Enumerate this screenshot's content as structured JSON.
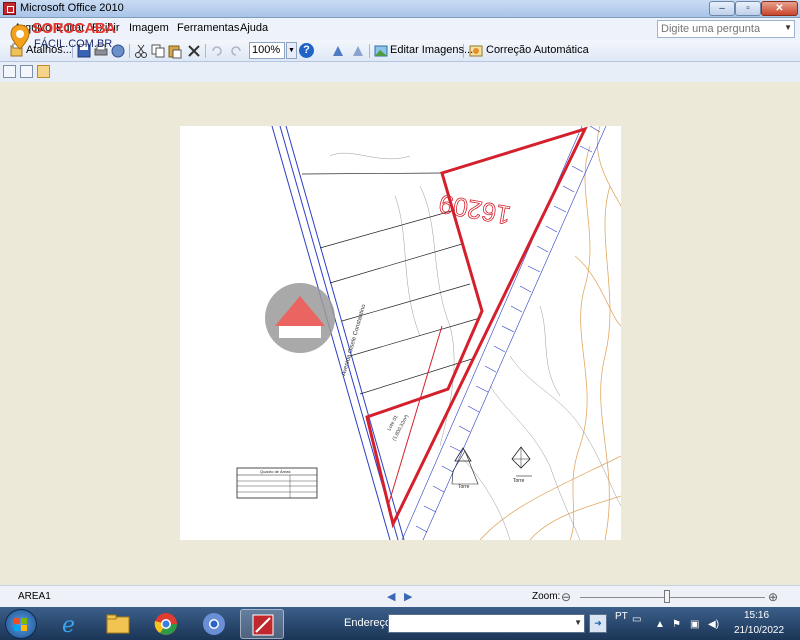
{
  "window": {
    "title": "Microsoft Office 2010"
  },
  "menu": [
    "Arquivo",
    "Editar",
    "Exibir",
    "Imagem",
    "Ferramentas",
    "Ajuda"
  ],
  "help_box": {
    "placeholder": "Digite uma pergunta"
  },
  "toolbar": {
    "atalhos_label": "Atalhos...",
    "zoom_value": "100%",
    "edit_images_label": "Editar Imagens...",
    "auto_correct_label": "Correção Automática"
  },
  "watermark": {
    "line1": "SOROCABA",
    "line2": "FÁCIL.COM.BR"
  },
  "document": {
    "stamp_number": "16209",
    "road_label": "Avenida Gisele Constantino",
    "lot_label": "Lote 01",
    "lot_area": "(1.800,32m²)",
    "tower_label_1": "Torre",
    "tower_label_2": "Torre",
    "table_title": "Quadro de Áreas"
  },
  "status": {
    "page_label": "AREA1",
    "zoom_label": "Zoom:",
    "zoom_level": 0.47
  },
  "taskbar": {
    "address_label": "Endereço",
    "language": "PT",
    "time": "15:16",
    "date": "21/10/2022"
  },
  "colors": {
    "lot_outline": "#d4202c",
    "road_lines": "#2b3fc4",
    "contours": "#e0a862",
    "title_bar": "#a9c4e8",
    "taskbar": "#1b3556"
  }
}
